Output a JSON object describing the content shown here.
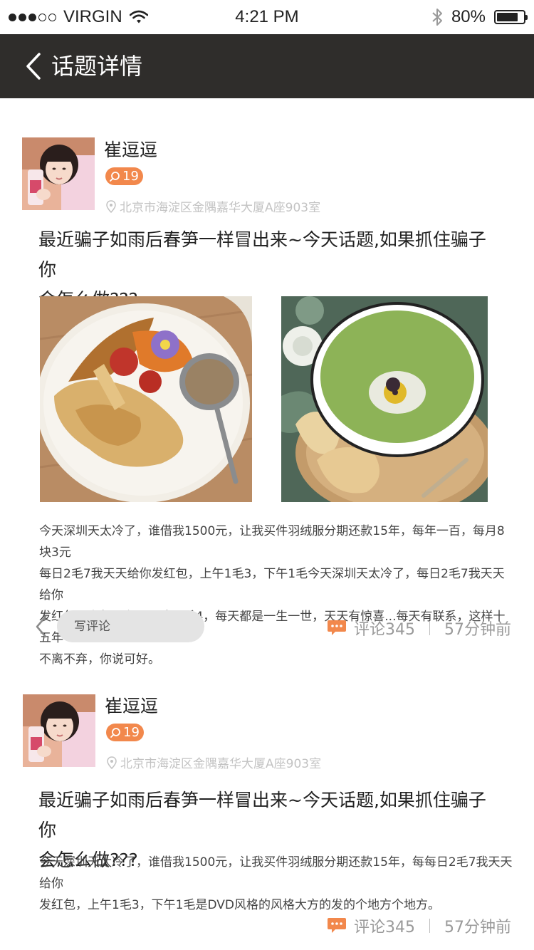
{
  "status_bar": {
    "carrier": "VIRGIN",
    "time": "4:21 PM",
    "battery_percent": "80%",
    "battery_level": 0.8,
    "signal_full": 3,
    "signal_total": 5
  },
  "nav": {
    "title": "话题详情"
  },
  "posts": [
    {
      "username": "崔逗逗",
      "badge_count": "19",
      "location": "北京市海淀区金隅嘉华大厦A座903室",
      "title_line1": "最近骗子如雨后春笋一样冒出来~今天话题,如果抓住骗子你",
      "title_line2": "会怎么做???",
      "body": [
        "今天深圳天太冷了，谁借我1500元，让我买件羽绒服分期还款15年，每年一百，每月8块3元",
        "每日2毛7我天天给你发红包，上午1毛3，下午1毛今天深圳天太冷了，每日2毛7我天天给你",
        "发红包，上午1毛3，下午1毛4，每天都是一生一世，天天有惊喜...每天有联系，这样十五年",
        "不离不弃，你说可好。"
      ],
      "comment_placeholder": "写评论",
      "comments_label": "评论345",
      "time_ago": "57分钟前"
    },
    {
      "username": "崔逗逗",
      "badge_count": "19",
      "location": "北京市海淀区金隅嘉华大厦A座903室",
      "title_line1": "最近骗子如雨后春笋一样冒出来~今天话题,如果抓住骗子你",
      "title_line2": "会怎么做???",
      "body": [
        "今天深圳天太冷了，谁借我1500元，让我买件羽绒服分期还款15年，每每日2毛7我天天给你",
        "发红包，上午1毛3，下午1毛是DVD风格的风格大方的发的个地方个地方。"
      ],
      "comments_label": "评论345",
      "time_ago": "57分钟前"
    }
  ],
  "colors": {
    "accent": "#f2884c",
    "nav_bg": "#2f2d2b",
    "meta_gray": "#9a9a9a"
  },
  "icons": [
    "back-arrow-icon",
    "search-badge-icon",
    "location-pin-icon",
    "chat-bubble-icon",
    "wifi-icon",
    "bluetooth-icon"
  ]
}
